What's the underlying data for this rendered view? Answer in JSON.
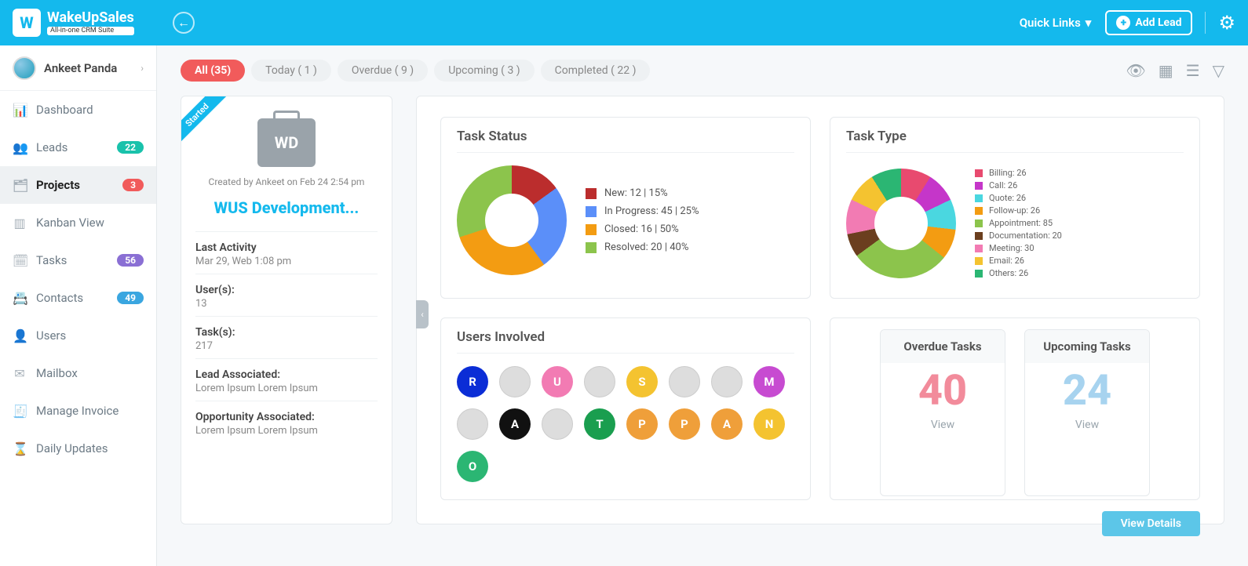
{
  "brand": {
    "name": "WakeUpSales",
    "tagline": "All-in-one CRM Suite"
  },
  "header": {
    "quicklinks": "Quick Links",
    "add_lead": "Add Lead"
  },
  "user": {
    "name": "Ankeet Panda"
  },
  "nav": [
    {
      "label": "Dashboard",
      "icon": "📊",
      "badge": null
    },
    {
      "label": "Leads",
      "icon": "👥",
      "badge": "22",
      "badge_cls": "b-teal"
    },
    {
      "label": "Projects",
      "icon": "🗂",
      "badge": "3",
      "badge_cls": "b-red",
      "active": true
    },
    {
      "label": "Kanban View",
      "icon": "▥",
      "badge": null
    },
    {
      "label": "Tasks",
      "icon": "🗓",
      "badge": "56",
      "badge_cls": "b-purple"
    },
    {
      "label": "Contacts",
      "icon": "📇",
      "badge": "49",
      "badge_cls": "b-blue"
    },
    {
      "label": "Users",
      "icon": "👤",
      "badge": null
    },
    {
      "label": "Mailbox",
      "icon": "✉",
      "badge": null
    },
    {
      "label": "Manage Invoice",
      "icon": "🧾",
      "badge": null
    },
    {
      "label": "Daily Updates",
      "icon": "⌛",
      "badge": null
    }
  ],
  "filters": [
    {
      "label": "All (35)",
      "active": true
    },
    {
      "label": "Today ( 1 )"
    },
    {
      "label": "Overdue  ( 9 )"
    },
    {
      "label": "Upcoming  ( 3 )"
    },
    {
      "label": "Completed  ( 22 )"
    }
  ],
  "project": {
    "ribbon": "Started",
    "initials": "WD",
    "created_by": "Created by Ankeet on Feb 24  2:54 pm",
    "name": "WUS Development...",
    "last_activity_label": "Last Activity",
    "last_activity": "Mar 29, Web 1:08 pm",
    "users_label": "User(s):",
    "users": "13",
    "tasks_label": "Task(s):",
    "tasks": "217",
    "lead_label": "Lead Associated:",
    "lead": "Lorem Ipsum Lorem Ipsum",
    "opp_label": "Opportunity Associated:",
    "opp": "Lorem Ipsum Lorem Ipsum"
  },
  "panels": {
    "task_status_title": "Task Status",
    "task_type_title": "Task Type",
    "users_title": "Users Involved",
    "overdue_title": "Overdue Tasks",
    "upcoming_title": "Upcoming Tasks",
    "overdue": "40",
    "upcoming": "24",
    "view": "View",
    "view_details": "View Details"
  },
  "users_involved": [
    {
      "t": "R",
      "c": "#0b2dd6"
    },
    {
      "t": "",
      "c": "photo"
    },
    {
      "t": "U",
      "c": "#f27bb3"
    },
    {
      "t": "",
      "c": "photo"
    },
    {
      "t": "S",
      "c": "#f4c330"
    },
    {
      "t": "",
      "c": "photo"
    },
    {
      "t": "",
      "c": "photo"
    },
    {
      "t": "M",
      "c": "#c74bd1"
    },
    {
      "t": "",
      "c": "photo"
    },
    {
      "t": "A",
      "c": "#111"
    },
    {
      "t": "",
      "c": "photo"
    },
    {
      "t": "T",
      "c": "#1a9e4f"
    },
    {
      "t": "P",
      "c": "#ef9f3a"
    },
    {
      "t": "P",
      "c": "#ef9f3a"
    },
    {
      "t": "A",
      "c": "#ef9f3a"
    },
    {
      "t": "N",
      "c": "#f4c330"
    },
    {
      "t": "O",
      "c": "#2bb673"
    }
  ],
  "chart_data": [
    {
      "type": "pie",
      "title": "Task Status",
      "series": [
        {
          "name": "New: 12 | 15%",
          "value": 15,
          "color": "#bb2d2d"
        },
        {
          "name": "In Progress: 45 | 25%",
          "value": 25,
          "color": "#5b8ff9"
        },
        {
          "name": "Closed: 16 | 50%",
          "value": 30,
          "color": "#f39c12"
        },
        {
          "name": "Resolved: 20 | 40%",
          "value": 30,
          "color": "#8cc44c"
        }
      ]
    },
    {
      "type": "pie",
      "title": "Task Type",
      "series": [
        {
          "name": "Billing: 26",
          "value": 26,
          "color": "#e84a6f"
        },
        {
          "name": "Call: 26",
          "value": 26,
          "color": "#c536c9"
        },
        {
          "name": "Quote: 26",
          "value": 26,
          "color": "#4ad7e0"
        },
        {
          "name": "Follow-up: 26",
          "value": 26,
          "color": "#f39c12"
        },
        {
          "name": "Appointment: 85",
          "value": 85,
          "color": "#8cc44c"
        },
        {
          "name": "Documentation: 20",
          "value": 20,
          "color": "#6b3f1f"
        },
        {
          "name": "Meeting: 30",
          "value": 30,
          "color": "#f27bb3"
        },
        {
          "name": "Email: 26",
          "value": 26,
          "color": "#f4c330"
        },
        {
          "name": "Others: 26",
          "value": 26,
          "color": "#2bb673"
        }
      ]
    }
  ]
}
